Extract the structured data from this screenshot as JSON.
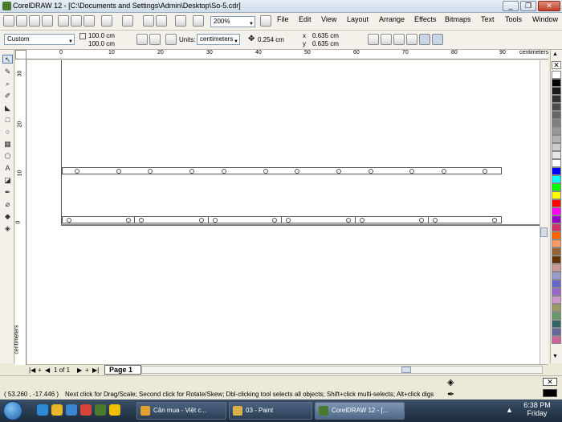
{
  "window": {
    "title": "CorelDRAW 12 - [C:\\Documents and Settings\\Admin\\Desktop\\So-5.cdr]",
    "controls": {
      "minimize": "_",
      "restore": "❐",
      "close": "✕"
    }
  },
  "menubar": {
    "items": [
      "File",
      "Edit",
      "View",
      "Layout",
      "Arrange",
      "Effects",
      "Bitmaps",
      "Text",
      "Tools",
      "Window"
    ]
  },
  "standard_toolbar": {
    "zoom_level": "200%"
  },
  "property_bar": {
    "page_size_preset": "Custom",
    "page_width": "100.0 cm",
    "page_height": "100.0 cm",
    "units_label": "Units:",
    "units_value": "centimeters",
    "nudge": "0.254 cm",
    "duplicate_x": "0.635 cm",
    "duplicate_y": "0.635 cm"
  },
  "rulers": {
    "horizontal_ticks": [
      "0",
      "10",
      "20",
      "30",
      "40",
      "50",
      "60",
      "70",
      "80",
      "90"
    ],
    "horizontal_unit": "centimeters",
    "vertical_ticks": [
      "30",
      "20",
      "10",
      "0"
    ],
    "vertical_unit": "centimeters"
  },
  "page_nav": {
    "counter": "1 of 1",
    "tab": "Page 1"
  },
  "status": {
    "coordinates": "( 53.260 , -17.446 )",
    "hint": "Next click for Drag/Scale; Second click for Rotate/Skew; Dbl-clicking tool selects all objects; Shift+click multi-selects; Alt+click digs"
  },
  "taskbar": {
    "apps": [
      {
        "label": "Căn mua - Việt c...",
        "icon_color": "#e0a030"
      },
      {
        "label": "03 - Paint",
        "icon_color": "#d9b24a"
      },
      {
        "label": "CorelDRAW 12 - [...",
        "icon_color": "#4a7a2c"
      }
    ],
    "time": "6:38 PM",
    "day": "Friday"
  },
  "palette_colors": [
    "#ffffff",
    "#000000",
    "#1a1a1a",
    "#333333",
    "#4d4d4d",
    "#666666",
    "#808080",
    "#999999",
    "#b3b3b3",
    "#cccccc",
    "#e6e6e6",
    "#ffffff",
    "#0000ff",
    "#00ffff",
    "#00ff00",
    "#ffff00",
    "#ff0000",
    "#ff00ff",
    "#9900cc",
    "#cc3366",
    "#ff6600",
    "#ff9966",
    "#996633",
    "#663300",
    "#cc9999",
    "#9999cc",
    "#6666cc",
    "#9966cc",
    "#cc99cc",
    "#999966",
    "#669966",
    "#336666",
    "#666699",
    "#cc6699"
  ]
}
